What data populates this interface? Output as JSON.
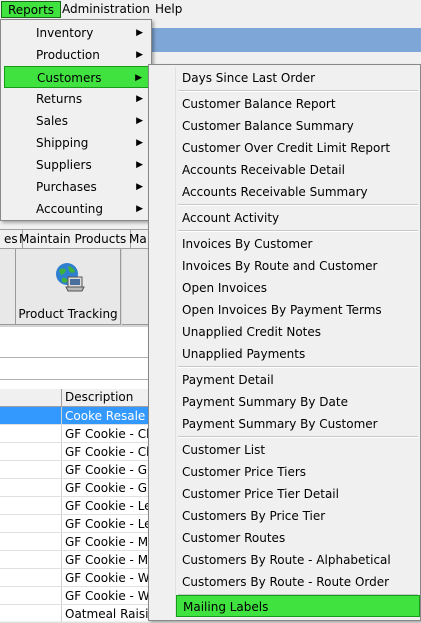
{
  "menubar": {
    "reports": "Reports",
    "administration": "Administration",
    "help": "Help"
  },
  "reports_menu": [
    {
      "label": "Inventory"
    },
    {
      "label": "Production"
    },
    {
      "label": "Customers"
    },
    {
      "label": "Returns"
    },
    {
      "label": "Sales"
    },
    {
      "label": "Shipping"
    },
    {
      "label": "Suppliers"
    },
    {
      "label": "Purchases"
    },
    {
      "label": "Accounting"
    }
  ],
  "customers_menu": [
    "Days Since Last Order",
    "Customer Balance Report",
    "Customer Balance Summary",
    "Customer Over Credit Limit Report",
    "Accounts Receivable Detail",
    "Accounts Receivable Summary",
    "Account Activity",
    "Invoices By Customer",
    "Invoices By Route and Customer",
    "Open Invoices",
    "Open Invoices By Payment Terms",
    "Unapplied Credit Notes",
    "Unapplied Payments",
    "Payment Detail",
    "Payment Summary By Date",
    "Payment Summary By Customer",
    "Customer List",
    "Customer Price Tiers",
    "Customer Price Tier Detail",
    "Customers By Price Tier",
    "Customer Routes",
    "Customers By Route - Alphabetical",
    "Customers By Route - Route Order",
    "Mailing Labels"
  ],
  "tabs": {
    "t1": "es",
    "t2": "Maintain Products",
    "t3": "Ma"
  },
  "toolbar": {
    "product_tracking": "Product Tracking"
  },
  "grid": {
    "header_description": "Description",
    "rows": [
      "Cooke Resale",
      "GF Cookie - Ch",
      "GF Cookie - Ch",
      "GF Cookie - Gi",
      "GF Cookie - Gi",
      "GF Cookie - Le",
      "GF Cookie - Le",
      "GF Cookie - M&",
      "GF Cookie - M&",
      "GF Cookie - Wh",
      "GF Cookie - Wh",
      "Oatmeal Raisin"
    ]
  },
  "colors": {
    "menu_highlight": "#3fe23f",
    "selection": "#3399ff",
    "header_blue": "#7ea6d6"
  }
}
